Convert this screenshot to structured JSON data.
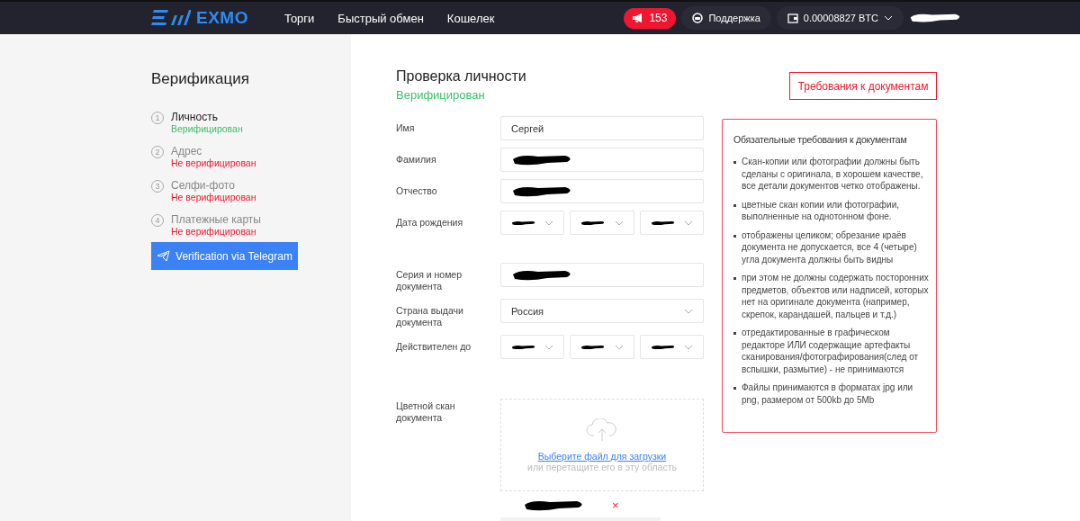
{
  "header": {
    "logo": "EXMO",
    "nav": [
      {
        "label": "Торги"
      },
      {
        "label": "Быстрый обмен"
      },
      {
        "label": "Кошелек"
      }
    ],
    "notifications": "153",
    "support": "Поддержка",
    "balance": "0.00008827 BTC"
  },
  "sidebar": {
    "title": "Верификация",
    "steps": [
      {
        "number": "1",
        "name": "Личность",
        "status": "Верифицирован",
        "verified": true,
        "selected": true
      },
      {
        "number": "2",
        "name": "Адрес",
        "status": "Не верифицирован",
        "verified": false,
        "selected": false
      },
      {
        "number": "3",
        "name": "Селфи-фото",
        "status": "Не верифицирован",
        "verified": false,
        "selected": false
      },
      {
        "number": "4",
        "name": "Платежные карты",
        "status": "Не верифицирован",
        "verified": false,
        "selected": false
      }
    ],
    "telegram_button": "Verification via Telegram"
  },
  "form": {
    "title": "Проверка личности",
    "status": "Верифицирован",
    "verified": true,
    "requirements_button": "Требования к документам",
    "personal_fields": [
      {
        "label": "Имя",
        "kind": "text",
        "value": "Сергей"
      },
      {
        "label": "Фамилия",
        "kind": "text",
        "redacted": true
      },
      {
        "label": "Отчество",
        "kind": "text",
        "redacted": true
      },
      {
        "label": "Дата рождения",
        "kind": "date",
        "parts": [
          {
            "redacted": true
          },
          {
            "redacted": true
          },
          {
            "redacted": true
          }
        ]
      }
    ],
    "document_fields": [
      {
        "label": "Серия и номер документа",
        "kind": "text",
        "redacted": true
      },
      {
        "label": "Страна выдачи документа",
        "kind": "select",
        "value": "Россия"
      },
      {
        "label": "Действителен до",
        "kind": "date",
        "parts": [
          {
            "redacted": true
          },
          {
            "redacted": true
          },
          {
            "redacted": true
          }
        ]
      }
    ],
    "upload": {
      "label": "Цветной скан документа",
      "link": "Выберите файл для загрузки",
      "hint": "или перетащите его в эту область",
      "file": {
        "redacted": true,
        "remove": "×"
      }
    }
  },
  "requirements": {
    "title": "Обязательные требования к документам",
    "items": [
      "Скан-копии или фотографии должны быть сделаны с оригинала, в хорошем качестве, все детали документов четко отображены.",
      "цветные скан копии или фотографии, выполненные на однотонном фоне.",
      "отображены целиком; обрезание краёв документа не допускается, все 4 (четыре) угла документа должны быть видны",
      "при этом не должны содержать посторонних предметов, объектов или надписей, которых нет на оригинале документа (например, скрепок, карандашей, пальцев и т.д.)",
      "отредактированные в графическом редакторе ИЛИ содержащие артефакты сканирования/фотографирования(след от вспышки, размытие) - не принимаются",
      "Файлы принимаются в форматах jpg или png, размером от 500kb до 5Mb"
    ]
  }
}
